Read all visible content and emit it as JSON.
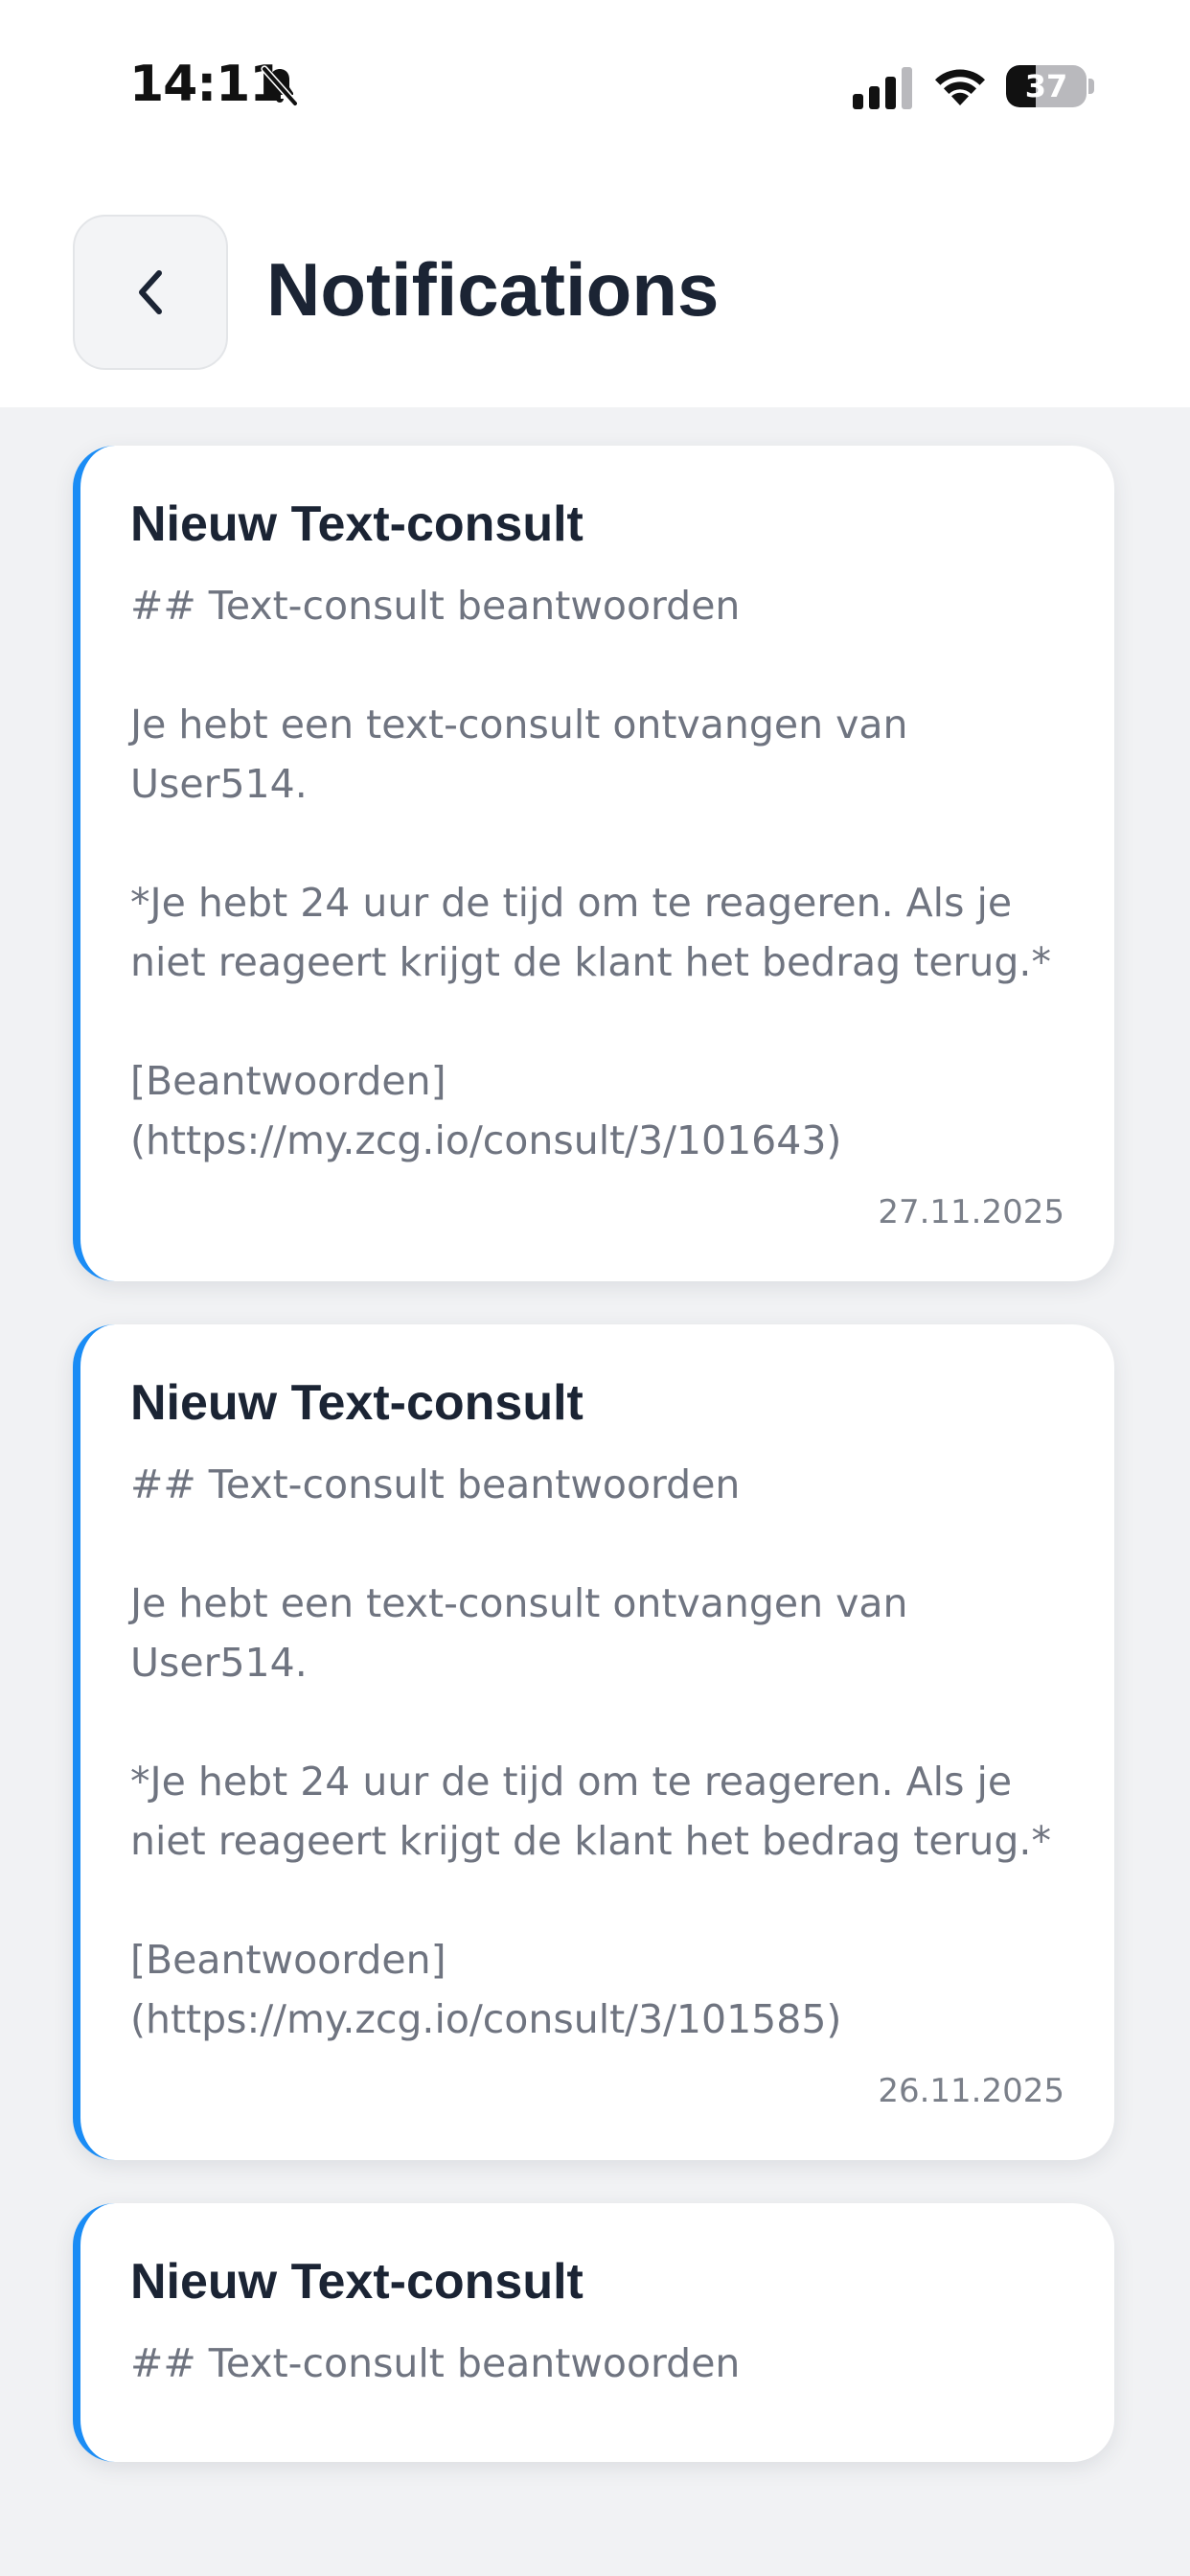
{
  "status_bar": {
    "time": "14:11",
    "battery_level": "37",
    "icons": [
      "bell-off-icon",
      "signal-icon",
      "wifi-icon",
      "battery-icon"
    ]
  },
  "header": {
    "back_icon": "chevron-left-icon",
    "title": "Notifications"
  },
  "colors": {
    "accent": "#1a8cf5",
    "title_text": "#1b2434",
    "body_text": "#6f7480",
    "background": "#f1f2f4"
  },
  "notifications": [
    {
      "title": "Nieuw Text-consult",
      "body": "## Text-consult beantwoorden\n\nJe hebt een text-consult ontvangen van User514.\n\n*Je hebt 24 uur de tijd om te reageren. Als je niet reageert krijgt de klant het bedrag terug.*\n\n[Beantwoorden](https://my.zcg.io/consult/3/101643)",
      "date": "27.11.2025"
    },
    {
      "title": "Nieuw Text-consult",
      "body": "## Text-consult beantwoorden\n\nJe hebt een text-consult ontvangen van User514.\n\n*Je hebt 24 uur de tijd om te reageren. Als je niet reageert krijgt de klant het bedrag terug.*\n\n[Beantwoorden](https://my.zcg.io/consult/3/101585)",
      "date": "26.11.2025"
    },
    {
      "title": "Nieuw Text-consult",
      "body": "## Text-consult beantwoorden",
      "date": ""
    }
  ]
}
